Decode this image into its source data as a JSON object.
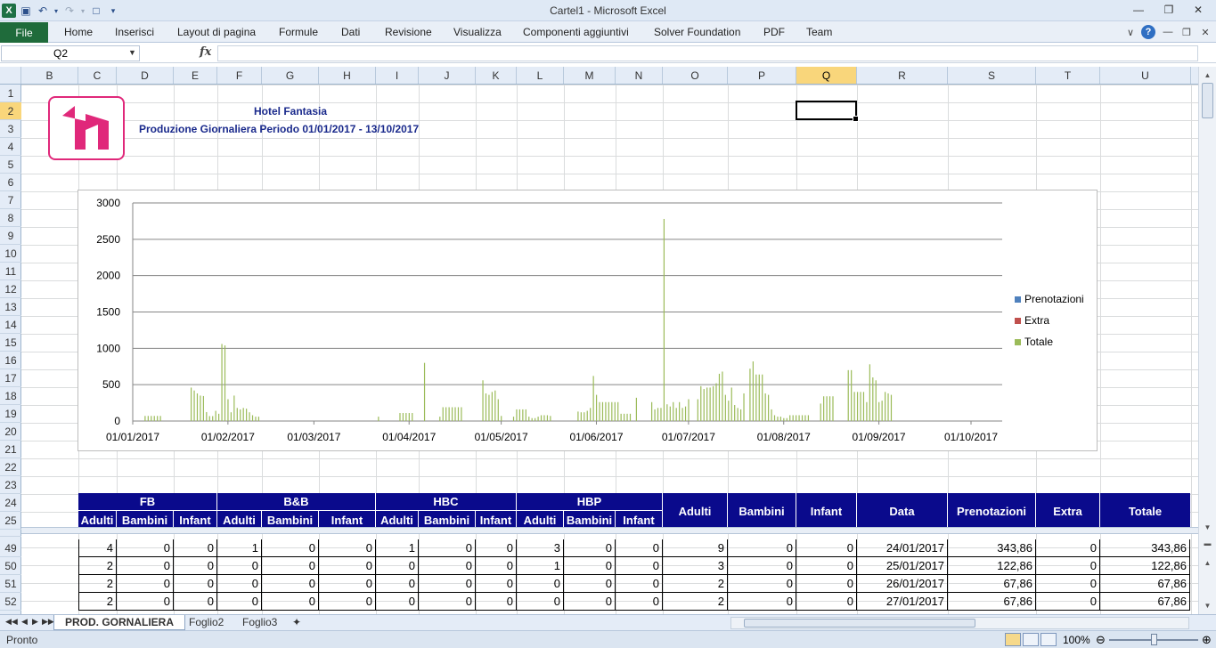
{
  "window": {
    "title": "Cartel1  -  Microsoft Excel"
  },
  "ribbon": {
    "file": "File",
    "tabs": [
      "Home",
      "Inserisci",
      "Layout di pagina",
      "Formule",
      "Dati",
      "Revisione",
      "Visualizza",
      "Componenti aggiuntivi",
      "Solver Foundation",
      "PDF",
      "Team"
    ]
  },
  "formula_bar": {
    "name_box": "Q2",
    "fx": "fx",
    "formula": ""
  },
  "columns": [
    "B",
    "C",
    "D",
    "E",
    "F",
    "G",
    "H",
    "I",
    "J",
    "K",
    "L",
    "M",
    "N",
    "O",
    "P",
    "Q",
    "R",
    "S",
    "T",
    "U"
  ],
  "selected_column": "Q",
  "rows_top": [
    "1",
    "2",
    "3",
    "4",
    "5",
    "6",
    "7",
    "8",
    "9",
    "10",
    "11",
    "12",
    "13",
    "14",
    "15",
    "16",
    "17",
    "18",
    "19",
    "20",
    "21",
    "22",
    "23",
    "24",
    "25"
  ],
  "rows_bottom": [
    "49",
    "50",
    "51",
    "52"
  ],
  "selected_row": "2",
  "header": {
    "hotel": "Hotel Fantasia",
    "period": "Produzione Giornaliera Periodo 01/01/2017 - 13/10/2017"
  },
  "brand_colors": {
    "logo": "#e0287a",
    "table_header": "#0a0a8c",
    "title_text": "#1a2a8c"
  },
  "chart_data": {
    "type": "bar",
    "x_tick_labels": [
      "01/01/2017",
      "01/02/2017",
      "01/03/2017",
      "01/04/2017",
      "01/05/2017",
      "01/06/2017",
      "01/07/2017",
      "01/08/2017",
      "01/09/2017",
      "01/10/2017"
    ],
    "x_range": [
      "01/01/2017",
      "01/10/2017"
    ],
    "y_ticks": [
      "0",
      "500",
      "1000",
      "1500",
      "2000",
      "2500",
      "3000"
    ],
    "ylim": [
      0,
      3000
    ],
    "grid": true,
    "legend_position": "right",
    "series": [
      {
        "name": "Prenotazioni",
        "color": "#4f81bd"
      },
      {
        "name": "Extra",
        "color": "#c0504d"
      },
      {
        "name": "Totale",
        "color": "#9bbb59",
        "points": [
          {
            "x": "05/01/2017",
            "y": 70
          },
          {
            "x": "06/01/2017",
            "y": 70
          },
          {
            "x": "07/01/2017",
            "y": 70
          },
          {
            "x": "08/01/2017",
            "y": 70
          },
          {
            "x": "09/01/2017",
            "y": 70
          },
          {
            "x": "10/01/2017",
            "y": 70
          },
          {
            "x": "20/01/2017",
            "y": 460
          },
          {
            "x": "21/01/2017",
            "y": 420
          },
          {
            "x": "22/01/2017",
            "y": 380
          },
          {
            "x": "23/01/2017",
            "y": 350
          },
          {
            "x": "24/01/2017",
            "y": 343.86
          },
          {
            "x": "25/01/2017",
            "y": 122.86
          },
          {
            "x": "26/01/2017",
            "y": 67.86
          },
          {
            "x": "27/01/2017",
            "y": 67.86
          },
          {
            "x": "28/01/2017",
            "y": 140
          },
          {
            "x": "29/01/2017",
            "y": 100
          },
          {
            "x": "30/01/2017",
            "y": 1060
          },
          {
            "x": "31/01/2017",
            "y": 1040
          },
          {
            "x": "01/02/2017",
            "y": 300
          },
          {
            "x": "02/02/2017",
            "y": 120
          },
          {
            "x": "03/02/2017",
            "y": 350
          },
          {
            "x": "04/02/2017",
            "y": 180
          },
          {
            "x": "05/02/2017",
            "y": 160
          },
          {
            "x": "06/02/2017",
            "y": 180
          },
          {
            "x": "07/02/2017",
            "y": 170
          },
          {
            "x": "08/02/2017",
            "y": 120
          },
          {
            "x": "09/02/2017",
            "y": 80
          },
          {
            "x": "10/02/2017",
            "y": 60
          },
          {
            "x": "11/02/2017",
            "y": 60
          },
          {
            "x": "22/03/2017",
            "y": 60
          },
          {
            "x": "29/03/2017",
            "y": 110
          },
          {
            "x": "30/03/2017",
            "y": 110
          },
          {
            "x": "31/03/2017",
            "y": 110
          },
          {
            "x": "01/04/2017",
            "y": 110
          },
          {
            "x": "02/04/2017",
            "y": 110
          },
          {
            "x": "06/04/2017",
            "y": 800
          },
          {
            "x": "11/04/2017",
            "y": 60
          },
          {
            "x": "12/04/2017",
            "y": 190
          },
          {
            "x": "13/04/2017",
            "y": 190
          },
          {
            "x": "14/04/2017",
            "y": 190
          },
          {
            "x": "15/04/2017",
            "y": 190
          },
          {
            "x": "16/04/2017",
            "y": 190
          },
          {
            "x": "17/04/2017",
            "y": 190
          },
          {
            "x": "18/04/2017",
            "y": 190
          },
          {
            "x": "25/04/2017",
            "y": 560
          },
          {
            "x": "26/04/2017",
            "y": 380
          },
          {
            "x": "27/04/2017",
            "y": 360
          },
          {
            "x": "28/04/2017",
            "y": 400
          },
          {
            "x": "29/04/2017",
            "y": 420
          },
          {
            "x": "30/04/2017",
            "y": 300
          },
          {
            "x": "01/05/2017",
            "y": 70
          },
          {
            "x": "05/05/2017",
            "y": 60
          },
          {
            "x": "06/05/2017",
            "y": 160
          },
          {
            "x": "07/05/2017",
            "y": 160
          },
          {
            "x": "08/05/2017",
            "y": 160
          },
          {
            "x": "09/05/2017",
            "y": 160
          },
          {
            "x": "10/05/2017",
            "y": 60
          },
          {
            "x": "11/05/2017",
            "y": 40
          },
          {
            "x": "12/05/2017",
            "y": 40
          },
          {
            "x": "13/05/2017",
            "y": 60
          },
          {
            "x": "14/05/2017",
            "y": 80
          },
          {
            "x": "15/05/2017",
            "y": 80
          },
          {
            "x": "16/05/2017",
            "y": 80
          },
          {
            "x": "17/05/2017",
            "y": 70
          },
          {
            "x": "26/05/2017",
            "y": 130
          },
          {
            "x": "27/05/2017",
            "y": 120
          },
          {
            "x": "28/05/2017",
            "y": 120
          },
          {
            "x": "29/05/2017",
            "y": 140
          },
          {
            "x": "30/05/2017",
            "y": 180
          },
          {
            "x": "31/05/2017",
            "y": 620
          },
          {
            "x": "01/06/2017",
            "y": 360
          },
          {
            "x": "02/06/2017",
            "y": 260
          },
          {
            "x": "03/06/2017",
            "y": 260
          },
          {
            "x": "04/06/2017",
            "y": 260
          },
          {
            "x": "05/06/2017",
            "y": 260
          },
          {
            "x": "06/06/2017",
            "y": 260
          },
          {
            "x": "07/06/2017",
            "y": 260
          },
          {
            "x": "08/06/2017",
            "y": 260
          },
          {
            "x": "09/06/2017",
            "y": 100
          },
          {
            "x": "10/06/2017",
            "y": 100
          },
          {
            "x": "11/06/2017",
            "y": 100
          },
          {
            "x": "12/06/2017",
            "y": 100
          },
          {
            "x": "14/06/2017",
            "y": 320
          },
          {
            "x": "19/06/2017",
            "y": 260
          },
          {
            "x": "20/06/2017",
            "y": 160
          },
          {
            "x": "21/06/2017",
            "y": 180
          },
          {
            "x": "22/06/2017",
            "y": 180
          },
          {
            "x": "23/06/2017",
            "y": 2780
          },
          {
            "x": "24/06/2017",
            "y": 230
          },
          {
            "x": "25/06/2017",
            "y": 200
          },
          {
            "x": "26/06/2017",
            "y": 260
          },
          {
            "x": "27/06/2017",
            "y": 180
          },
          {
            "x": "28/06/2017",
            "y": 260
          },
          {
            "x": "29/06/2017",
            "y": 180
          },
          {
            "x": "30/06/2017",
            "y": 200
          },
          {
            "x": "01/07/2017",
            "y": 300
          },
          {
            "x": "04/07/2017",
            "y": 300
          },
          {
            "x": "05/07/2017",
            "y": 480
          },
          {
            "x": "06/07/2017",
            "y": 440
          },
          {
            "x": "07/07/2017",
            "y": 460
          },
          {
            "x": "08/07/2017",
            "y": 460
          },
          {
            "x": "09/07/2017",
            "y": 480
          },
          {
            "x": "10/07/2017",
            "y": 520
          },
          {
            "x": "11/07/2017",
            "y": 650
          },
          {
            "x": "12/07/2017",
            "y": 680
          },
          {
            "x": "13/07/2017",
            "y": 360
          },
          {
            "x": "14/07/2017",
            "y": 280
          },
          {
            "x": "15/07/2017",
            "y": 460
          },
          {
            "x": "16/07/2017",
            "y": 220
          },
          {
            "x": "17/07/2017",
            "y": 180
          },
          {
            "x": "18/07/2017",
            "y": 160
          },
          {
            "x": "19/07/2017",
            "y": 380
          },
          {
            "x": "21/07/2017",
            "y": 720
          },
          {
            "x": "22/07/2017",
            "y": 820
          },
          {
            "x": "23/07/2017",
            "y": 640
          },
          {
            "x": "24/07/2017",
            "y": 640
          },
          {
            "x": "25/07/2017",
            "y": 640
          },
          {
            "x": "26/07/2017",
            "y": 380
          },
          {
            "x": "27/07/2017",
            "y": 360
          },
          {
            "x": "28/07/2017",
            "y": 160
          },
          {
            "x": "29/07/2017",
            "y": 80
          },
          {
            "x": "30/07/2017",
            "y": 60
          },
          {
            "x": "31/07/2017",
            "y": 60
          },
          {
            "x": "01/08/2017",
            "y": 40
          },
          {
            "x": "02/08/2017",
            "y": 40
          },
          {
            "x": "03/08/2017",
            "y": 80
          },
          {
            "x": "04/08/2017",
            "y": 80
          },
          {
            "x": "05/08/2017",
            "y": 80
          },
          {
            "x": "06/08/2017",
            "y": 80
          },
          {
            "x": "07/08/2017",
            "y": 80
          },
          {
            "x": "08/08/2017",
            "y": 80
          },
          {
            "x": "09/08/2017",
            "y": 80
          },
          {
            "x": "13/08/2017",
            "y": 240
          },
          {
            "x": "14/08/2017",
            "y": 340
          },
          {
            "x": "15/08/2017",
            "y": 340
          },
          {
            "x": "16/08/2017",
            "y": 340
          },
          {
            "x": "17/08/2017",
            "y": 340
          },
          {
            "x": "22/08/2017",
            "y": 700
          },
          {
            "x": "23/08/2017",
            "y": 700
          },
          {
            "x": "24/08/2017",
            "y": 400
          },
          {
            "x": "25/08/2017",
            "y": 400
          },
          {
            "x": "26/08/2017",
            "y": 400
          },
          {
            "x": "27/08/2017",
            "y": 400
          },
          {
            "x": "28/08/2017",
            "y": 260
          },
          {
            "x": "29/08/2017",
            "y": 780
          },
          {
            "x": "30/08/2017",
            "y": 600
          },
          {
            "x": "31/08/2017",
            "y": 560
          },
          {
            "x": "01/09/2017",
            "y": 260
          },
          {
            "x": "02/09/2017",
            "y": 280
          },
          {
            "x": "03/09/2017",
            "y": 400
          },
          {
            "x": "04/09/2017",
            "y": 380
          },
          {
            "x": "05/09/2017",
            "y": 360
          }
        ]
      }
    ]
  },
  "table": {
    "groups": [
      "FB",
      "B&B",
      "HBC",
      "HBP"
    ],
    "sub": [
      "Adulti",
      "Bambini",
      "Infant"
    ],
    "totals": [
      "Adulti",
      "Bambini",
      "Infant",
      "Data",
      "Prenotazioni",
      "Extra",
      "Totale"
    ],
    "rows": [
      [
        "4",
        "0",
        "0",
        "1",
        "0",
        "0",
        "1",
        "0",
        "0",
        "3",
        "0",
        "0",
        "9",
        "0",
        "0",
        "24/01/2017",
        "343,86",
        "0",
        "343,86"
      ],
      [
        "2",
        "0",
        "0",
        "0",
        "0",
        "0",
        "0",
        "0",
        "0",
        "1",
        "0",
        "0",
        "3",
        "0",
        "0",
        "25/01/2017",
        "122,86",
        "0",
        "122,86"
      ],
      [
        "2",
        "0",
        "0",
        "0",
        "0",
        "0",
        "0",
        "0",
        "0",
        "0",
        "0",
        "0",
        "2",
        "0",
        "0",
        "26/01/2017",
        "67,86",
        "0",
        "67,86"
      ],
      [
        "2",
        "0",
        "0",
        "0",
        "0",
        "0",
        "0",
        "0",
        "0",
        "0",
        "0",
        "0",
        "2",
        "0",
        "0",
        "27/01/2017",
        "67,86",
        "0",
        "67,86"
      ]
    ]
  },
  "sheets": [
    "PROD. GORNALIERA",
    "Foglio2",
    "Foglio3"
  ],
  "status": {
    "ready": "Pronto",
    "zoom": "100%"
  }
}
